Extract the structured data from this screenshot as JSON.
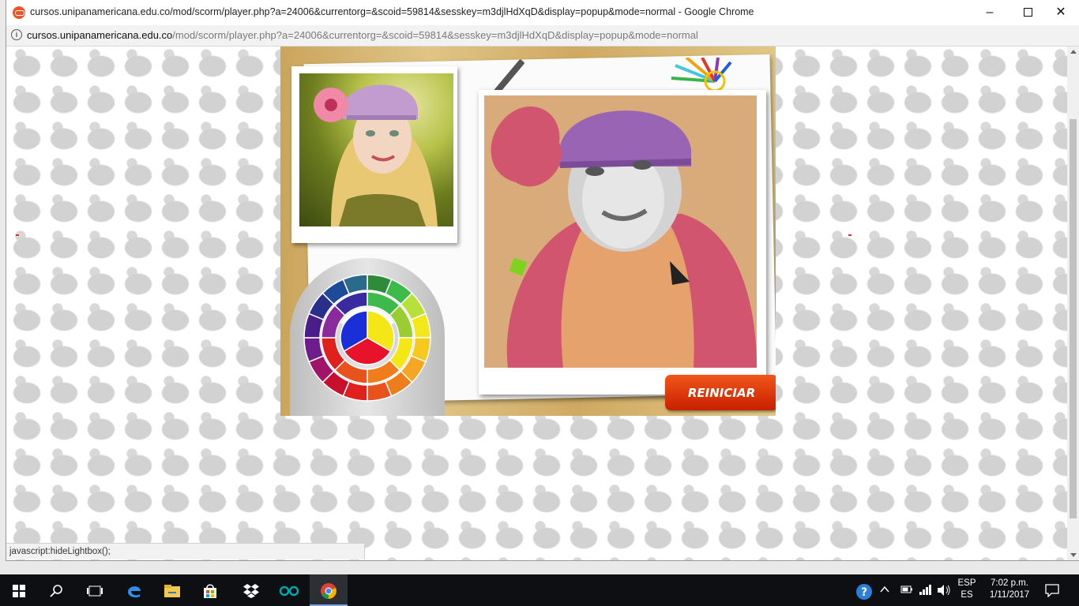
{
  "window": {
    "title": "cursos.unipanamericana.edu.co/mod/scorm/player.php?a=24006&currentorg=&scoid=59814&sesskey=m3djlHdXqD&display=popup&mode=normal - Google Chrome",
    "min": "–",
    "close": "✕"
  },
  "address": {
    "host": "cursos.unipanamericana.edu.co",
    "path": "/mod/scorm/player.php?a=24006&currentorg=&scoid=59814&sesskey=m3djlHdXqD&display=popup&mode=normal"
  },
  "activity": {
    "restart_label": "REINICIAR"
  },
  "status_bar": {
    "text": "javascript:hideLightbox();"
  },
  "taskbar": {
    "icons": [
      "windows-start-icon",
      "search-icon",
      "task-view-icon",
      "edge-icon",
      "file-explorer-icon",
      "store-icon",
      "dropbox-icon",
      "arduino-icon",
      "chrome-icon"
    ],
    "language_top": "ESP",
    "language_bottom": "ES",
    "time": "7:02 p.m.",
    "date": "1/11/2017"
  },
  "colors": {
    "accent_button": "#e23a0a",
    "wheel_primary": [
      "#e8132b",
      "#f5e616",
      "#1b2fd8"
    ]
  }
}
